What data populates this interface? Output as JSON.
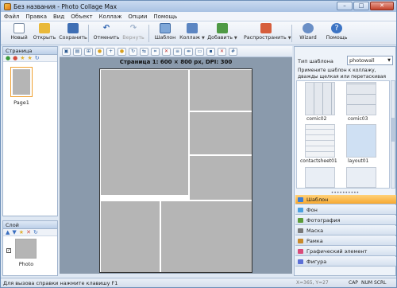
{
  "window": {
    "title": "Без названия - Photo Collage Max",
    "caption_minimize": "–",
    "caption_maximize": "□",
    "caption_close": "✕"
  },
  "menu": [
    "Файл",
    "Правка",
    "Вид",
    "Объект",
    "Коллаж",
    "Опции",
    "Помощь"
  ],
  "toolbar": {
    "new": "Новый",
    "open": "Открыть",
    "save": "Сохранить",
    "undo": "Отменить",
    "redo": "Вернуть",
    "template": "Шаблон",
    "collage": "Коллаж",
    "add": "Добавить",
    "distribute": "Распространить",
    "wizard": "Wizard",
    "help": "Помощь"
  },
  "left_panel": {
    "pages_title": "Страница",
    "page_label": "Page1",
    "layers_title": "Слой",
    "layer_label": "Photo"
  },
  "canvas": {
    "page_info": "Страница 1: 600 × 800 px, DPI: 300"
  },
  "right_panel": {
    "template_type_label": "Тип шаблона",
    "template_type_value": "photowall",
    "hint": "Примените шаблон к коллажу, дважды щелкая или перетаскивая",
    "templates": [
      "comic02",
      "comic03",
      "contactsheet01",
      "layout01"
    ],
    "section_title": "Шаблон",
    "list": [
      {
        "label": "Шаблон",
        "color": "#3a7dd8"
      },
      {
        "label": "Фон",
        "color": "#4aa0e0"
      },
      {
        "label": "Фотография",
        "color": "#5d9c3a"
      },
      {
        "label": "Маска",
        "color": "#7a7a7a"
      },
      {
        "label": "Рамка",
        "color": "#c98a2b"
      },
      {
        "label": "Графический элемент",
        "color": "#d94b7a"
      },
      {
        "label": "Фигура",
        "color": "#5b6fd6"
      }
    ]
  },
  "status": {
    "help_text": "Для вызова справки нажмите клавишу F1",
    "coords": "X=365, Y=27",
    "caps": "CAP",
    "num": "NUM",
    "scrl": "SCRL"
  },
  "colors": {
    "accent": "#f7a830",
    "titlebar": "#a9c2e3",
    "panel_border": "#9fb3cd"
  }
}
